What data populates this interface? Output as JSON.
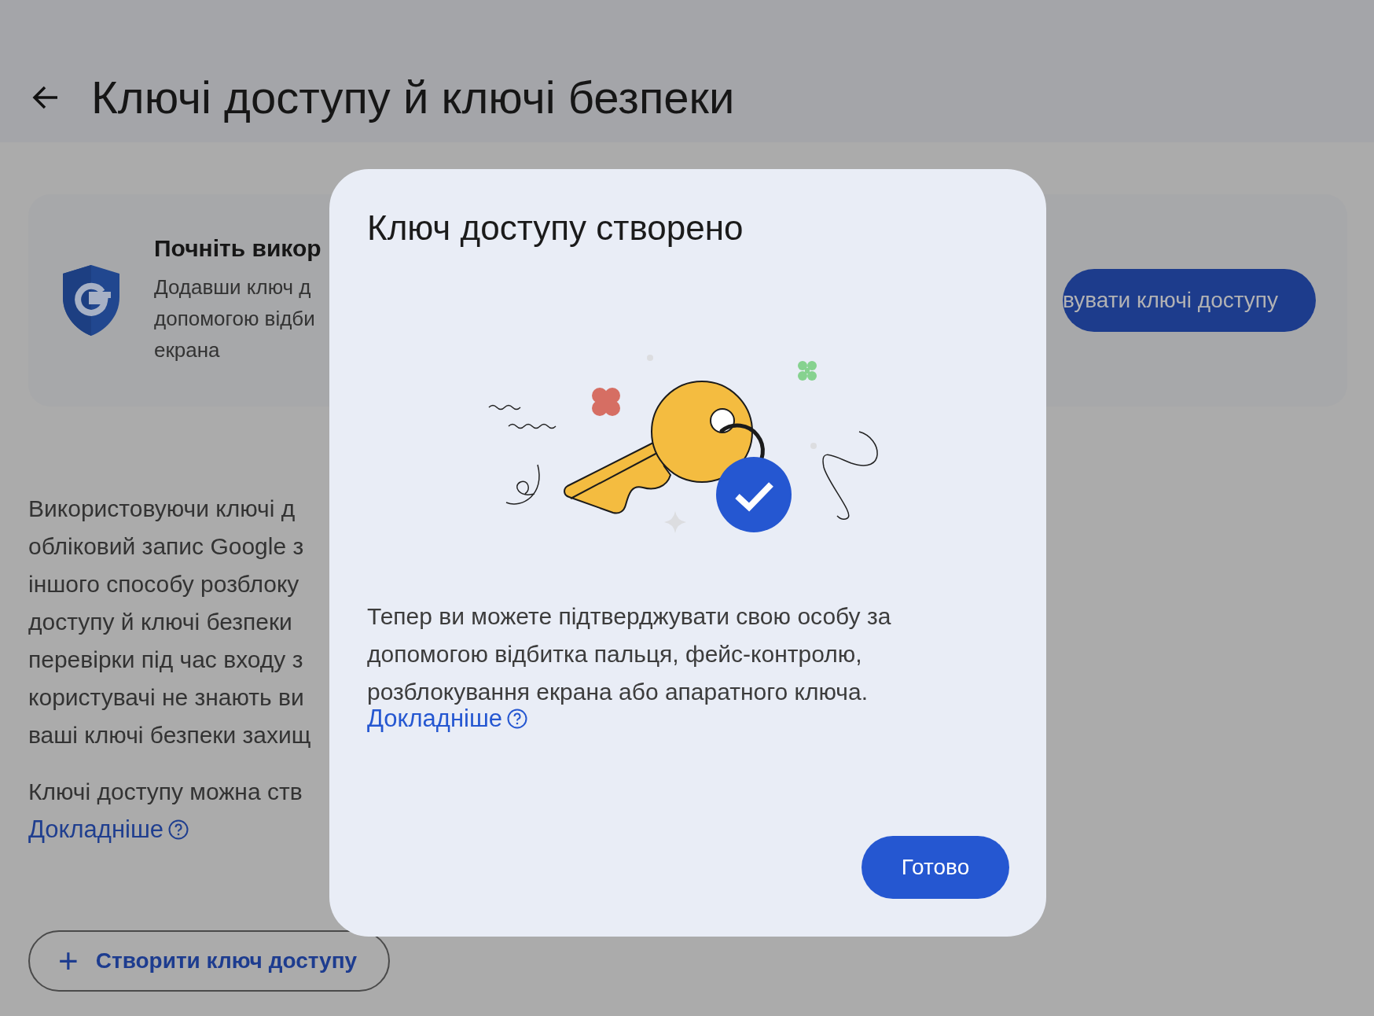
{
  "header": {
    "title": "Ключі доступу й ключі безпеки"
  },
  "promo_card": {
    "title": "Почніть викор",
    "lines": [
      "Додавши ключ д",
      "допомогою відби",
      "екрана"
    ],
    "button": "вувати ключі доступу"
  },
  "body": {
    "paragraph_1": [
      "Використовуючи ключі д",
      "обліковий запис Google з",
      "іншого способу розблоку",
      "доступу й ключі безпеки",
      "перевірки під час входу з",
      "користувачі не знають ви",
      "ваші ключі безпеки захищ"
    ],
    "paragraph_2": "Ключі доступу можна ств",
    "link": "Докладніше"
  },
  "create_button": {
    "icon": "+",
    "label": "Створити ключ доступу"
  },
  "dialog": {
    "title": "Ключ доступу створено",
    "text": "Тепер ви можете підтверджувати свою особу за допомогою відбитка пальця, фейс-контролю, розблокування екрана або апаратного ключа.",
    "link": "Докладніше",
    "button": "Готово"
  }
}
